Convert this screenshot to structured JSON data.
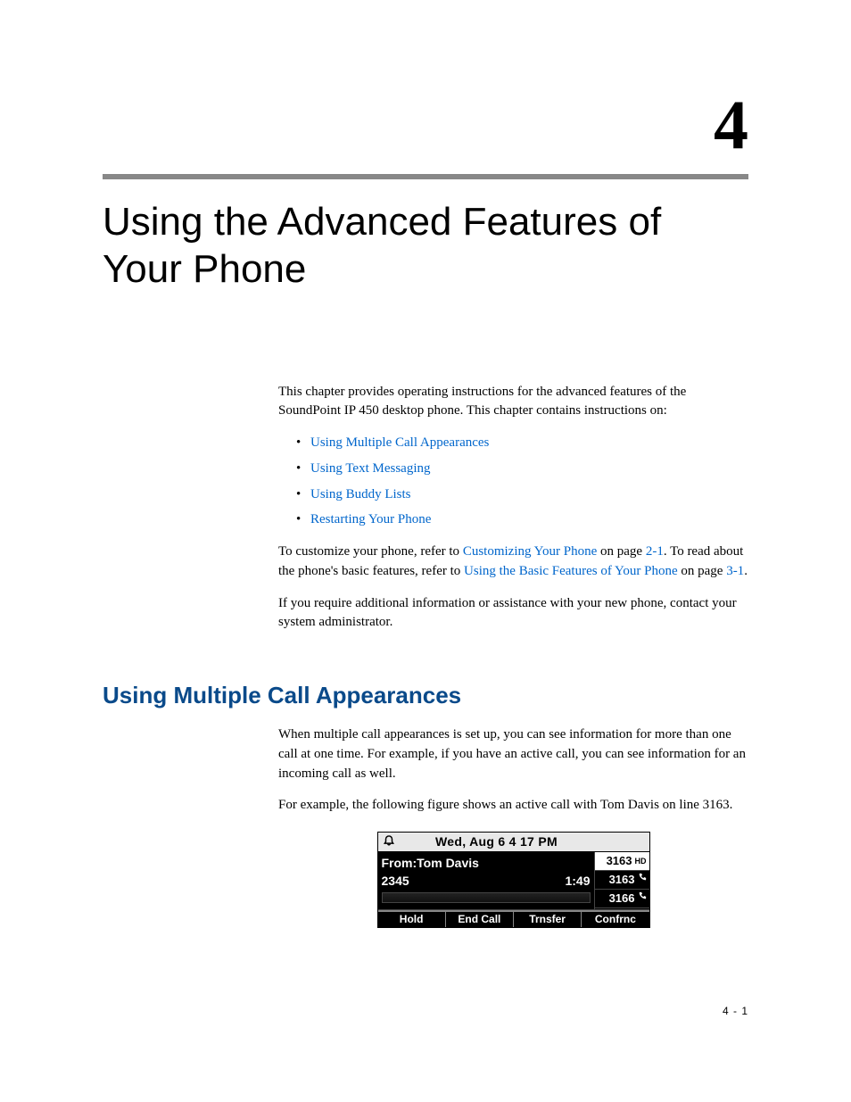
{
  "chapter_number": "4",
  "chapter_title": "Using the Advanced Features of Your Phone",
  "intro_para": "This chapter provides operating instructions for the advanced features of the SoundPoint IP 450 desktop phone. This chapter contains instructions on:",
  "toc": [
    "Using Multiple Call Appearances",
    "Using Text Messaging",
    "Using Buddy Lists",
    "Restarting Your Phone"
  ],
  "cross_ref_para": {
    "pre1": "To customize your phone, refer to ",
    "link1": "Customizing Your Phone",
    "mid1": " on page ",
    "pageref1": "2-1",
    "post1": ". To read about the phone's basic features, refer to ",
    "link2": "Using the Basic Features of Your Phone",
    "mid2": " on page ",
    "pageref2": "3-1",
    "post2": "."
  },
  "assist_para": "If you require additional information or assistance with your new phone, contact your system administrator.",
  "section_heading": "Using Multiple Call Appearances",
  "section_para1": "When multiple call appearances is set up, you can see information for more than one call at one time. For example, if you have an active call, you can see information for an incoming call as well.",
  "section_para2": "For example, the following figure shows an active call with Tom Davis on line 3163.",
  "phone": {
    "datetime": "Wed, Aug 6   4 17 PM",
    "from_label": "From:Tom Davis",
    "caller_num": "2345",
    "duration": "1:49",
    "lines": [
      {
        "number": "3163",
        "tag": "HD",
        "active": true
      },
      {
        "number": "3163",
        "tag": "phone",
        "active": false
      },
      {
        "number": "3166",
        "tag": "phone",
        "active": false
      }
    ],
    "softkeys": [
      "Hold",
      "End Call",
      "Trnsfer",
      "Confrnc"
    ],
    "icons": {
      "bell": "bell-icon",
      "phone": "phone-icon"
    }
  },
  "footer_page": "4 - 1"
}
